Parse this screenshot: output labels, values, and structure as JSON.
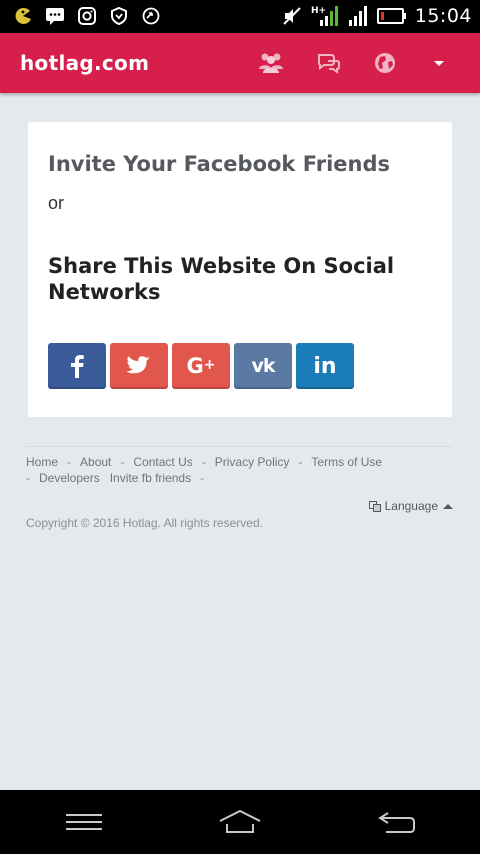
{
  "status_bar": {
    "time": "15:04",
    "icons": [
      "pacman-icon",
      "chat-icon",
      "instagram-icon",
      "shield-icon",
      "sync-icon",
      "mute-icon",
      "signal-hplus-icon",
      "signal-icon",
      "battery-low-icon"
    ]
  },
  "appbar": {
    "brand": "hotlag.com",
    "icons": [
      "users-icon",
      "chat-bubbles-icon",
      "globe-icon",
      "caret-down-icon"
    ],
    "color": "#d61f4b"
  },
  "card": {
    "invite_title": "Invite Your Facebook Friends",
    "or": "or",
    "share_title": "Share This Website On Social Networks",
    "social_buttons": [
      {
        "name": "facebook",
        "glyph": "f",
        "color": "#3b5a9a"
      },
      {
        "name": "twitter",
        "glyph": "twitter-bird",
        "color": "#e2574c"
      },
      {
        "name": "google-plus",
        "glyph": "G+",
        "color": "#e2574c"
      },
      {
        "name": "vk",
        "glyph": "vk",
        "color": "#5b7aa3"
      },
      {
        "name": "linkedin",
        "glyph": "in",
        "color": "#1a7db8"
      }
    ]
  },
  "footer": {
    "links": [
      "Home",
      "About",
      "Contact Us",
      "Privacy Policy",
      "Terms of Use",
      "Developers",
      "Invite fb friends"
    ],
    "separator": "-",
    "language": "Language",
    "copyright": "Copyright © 2016 Hotlag. All rights reserved."
  },
  "navbar": {
    "icons": [
      "menu-icon",
      "home-icon",
      "back-icon"
    ]
  }
}
